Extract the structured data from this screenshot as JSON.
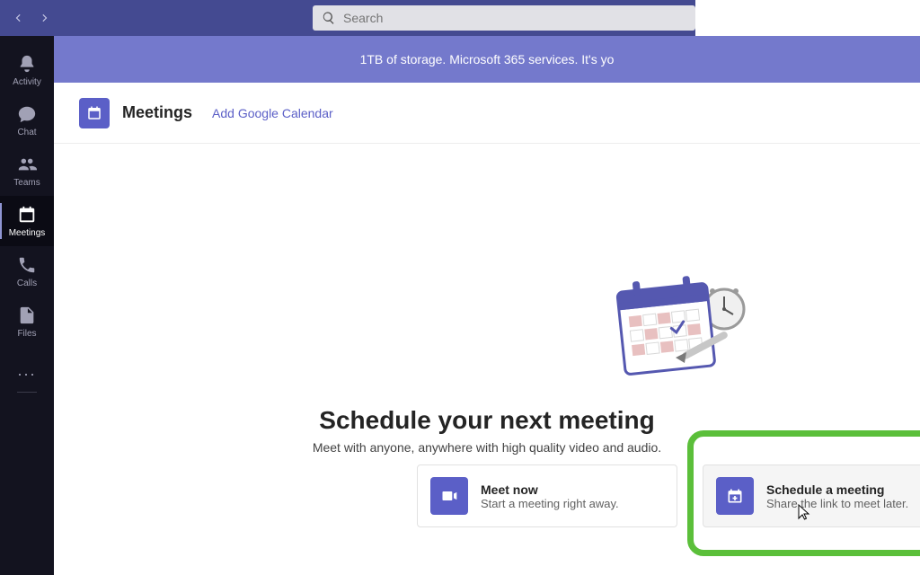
{
  "titlebar": {
    "search_placeholder": "Search"
  },
  "rail": {
    "items": [
      {
        "label": "Activity"
      },
      {
        "label": "Chat"
      },
      {
        "label": "Teams"
      },
      {
        "label": "Meetings"
      },
      {
        "label": "Calls"
      },
      {
        "label": "Files"
      }
    ],
    "more": "..."
  },
  "banner": {
    "text": "1TB of storage. Microsoft 365 services. It's yo"
  },
  "header": {
    "title": "Meetings",
    "add_calendar": "Add Google Calendar"
  },
  "hero": {
    "title": "Schedule your next meeting",
    "subtitle": "Meet with anyone, anywhere with high quality video and audio."
  },
  "cards": {
    "meet_now": {
      "title": "Meet now",
      "subtitle": "Start a meeting right away."
    },
    "schedule": {
      "title": "Schedule a meeting",
      "subtitle": "Share the link to meet later."
    }
  }
}
